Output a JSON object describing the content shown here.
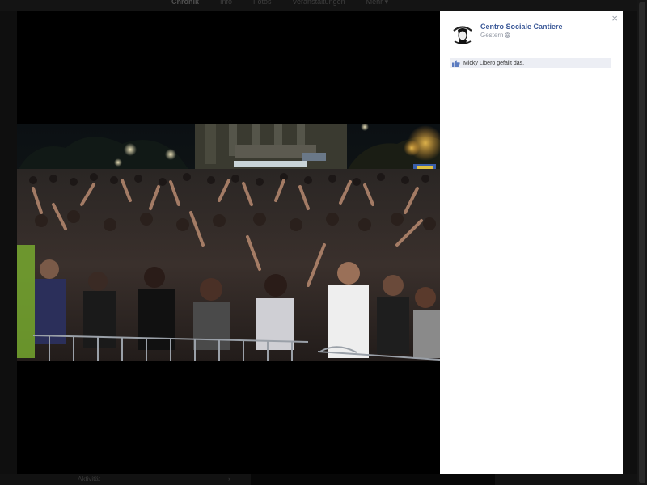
{
  "background": {
    "tabs": [
      "Chronik",
      "Info",
      "Fotos",
      "Veranstaltungen",
      "Mehr ▾"
    ],
    "bottom_label": "Aktivität",
    "bottom_arrow": "›"
  },
  "post": {
    "page_name": "Centro Sociale Cantiere",
    "timestamp": "Gestern",
    "privacy_icon": "globe-icon",
    "likes_text": "Micky Libero gefällt das.",
    "close_label": "×"
  },
  "photo": {
    "subject": "crowd-at-night-concert"
  },
  "colors": {
    "link": "#3b5998",
    "meta": "#9197a3",
    "likes_bg": "#eceef4",
    "theater_bg": "#000000"
  }
}
